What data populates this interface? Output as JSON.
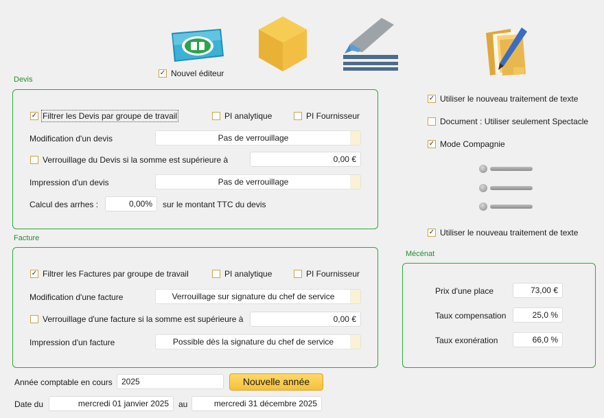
{
  "top": {
    "nouvel_editeur": {
      "label": "Nouvel éditeur",
      "checked": true
    }
  },
  "devis": {
    "title": "Devis",
    "filtrer": {
      "label": "Filtrer les Devis par groupe de travail",
      "checked": true
    },
    "pi_analytique": {
      "label": "PI analytique",
      "checked": false
    },
    "pi_fournisseur": {
      "label": "PI Fournisseur",
      "checked": false
    },
    "modification_label": "Modification d'un devis",
    "modification_value": "Pas de verrouillage",
    "verrouillage": {
      "label": "Verrouillage du Devis si la somme est supérieure à",
      "checked": false
    },
    "verrouillage_value": "0,00 €",
    "impression_label": "Impression d'un devis",
    "impression_value": "Pas de verrouillage",
    "arrhes_label": "Calcul des arrhes :",
    "arrhes_value": "0,00%",
    "arrhes_suffix": "sur le montant TTC du devis"
  },
  "facture": {
    "title": "Facture",
    "filtrer": {
      "label": "Filtrer les Factures par groupe de travail",
      "checked": true
    },
    "pi_analytique": {
      "label": "PI analytique",
      "checked": false
    },
    "pi_fournisseur": {
      "label": "PI Fournisseur",
      "checked": false
    },
    "modification_label": "Modification d'une facture",
    "modification_value": "Verrouillage sur signature du chef de service",
    "verrouillage": {
      "label": "Verrouillage d'une facture si la somme est supérieure à",
      "checked": false
    },
    "verrouillage_value": "0,00 €",
    "impression_label": "Impression d'un facture",
    "impression_value": "Possible dès la signature du chef de service"
  },
  "right": {
    "nouveau_traitement_1": {
      "label": "Utiliser le nouveau traitement de texte",
      "checked": true
    },
    "document_spectacle": {
      "label": "Document : Utiliser seulement Spectacle",
      "checked": false
    },
    "mode_compagnie": {
      "label": "Mode Compagnie",
      "checked": true
    },
    "nouveau_traitement_2": {
      "label": "Utiliser le nouveau traitement de texte",
      "checked": true
    }
  },
  "mecenat": {
    "title": "Mécénat",
    "prix_label": "Prix d'une place",
    "prix_value": "73,00 €",
    "compensation_label": "Taux compensation",
    "compensation_value": "25,0 %",
    "exoneration_label": "Taux exonération",
    "exoneration_value": "66,0 %"
  },
  "bottom": {
    "annee_label": "Année comptable en cours",
    "annee_value": "2025",
    "nouvelle_annee_label": "Nouvelle année",
    "date_du_label": "Date du",
    "date_du_value": "mercredi 01 janvier 2025",
    "au_label": "au",
    "date_au_value": "mercredi 31 décembre 2025"
  },
  "colors": {
    "group_border": "#2ea53a",
    "group_title": "#1f8f2b",
    "accent": "#f5c23a"
  }
}
